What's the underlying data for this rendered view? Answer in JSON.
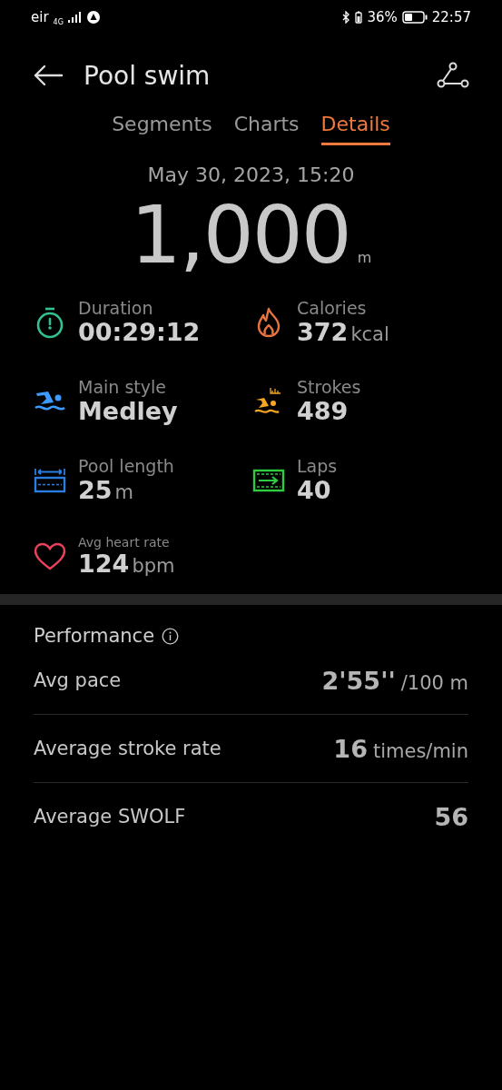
{
  "status_bar": {
    "carrier": "eir",
    "network": "4G",
    "battery_percent": "36%",
    "time": "22:57"
  },
  "header": {
    "title": "Pool swim"
  },
  "tabs": [
    {
      "label": "Segments",
      "selected": false
    },
    {
      "label": "Charts",
      "selected": false
    },
    {
      "label": "Details",
      "selected": true
    }
  ],
  "summary": {
    "date": "May 30, 2023, 15:20",
    "distance": "1,000",
    "unit": "m"
  },
  "metrics": [
    {
      "kind": "duration",
      "label": "Duration",
      "value": "00:29:12"
    },
    {
      "kind": "calories",
      "label": "Calories",
      "value": "372",
      "unit": "kcal"
    },
    {
      "kind": "style",
      "label": "Main style",
      "value": "Medley"
    },
    {
      "kind": "strokes",
      "label": "Strokes",
      "value": "489"
    },
    {
      "kind": "pool",
      "label": "Pool length",
      "value": "25",
      "unit": "m"
    },
    {
      "kind": "laps",
      "label": "Laps",
      "value": "40"
    },
    {
      "kind": "heart",
      "label": "Avg heart rate",
      "value": "124",
      "unit": "bpm",
      "small_label": true
    }
  ],
  "performance": {
    "title": "Performance",
    "rows": [
      {
        "label": "Avg pace",
        "value": "2'55''",
        "unit": "/100 m"
      },
      {
        "label": "Average stroke rate",
        "value": "16",
        "unit": "times/min"
      },
      {
        "label": "Average SWOLF",
        "value": "56"
      }
    ]
  }
}
